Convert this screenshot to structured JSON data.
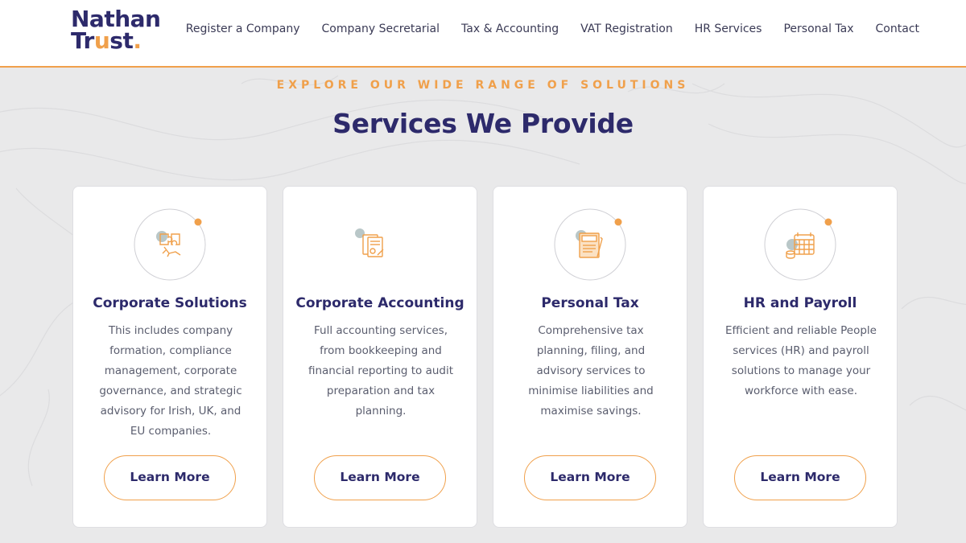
{
  "brand": {
    "line1": "Nathan",
    "line2_a": "Tr",
    "line2_b": "u",
    "line2_c": "st",
    "dot": "."
  },
  "nav": [
    "Register a Company",
    "Company Secretarial",
    "Tax & Accounting",
    "VAT Registration",
    "HR Services",
    "Personal Tax",
    "Contact"
  ],
  "section": {
    "eyebrow": "EXPLORE OUR WIDE RANGE OF SOLUTIONS",
    "title": "Services We Provide"
  },
  "cards": [
    {
      "icon": "puzzle-hand-icon",
      "title": "Corporate Solutions",
      "text": "This includes company formation, compliance management, corporate governance, and strategic advisory for Irish, UK, and EU companies.",
      "button": "Learn More"
    },
    {
      "icon": "accounting-document-icon",
      "title": "Corporate Accounting",
      "text": "Full accounting services, from bookkeeping and financial reporting to audit preparation and tax planning.",
      "button": "Learn More"
    },
    {
      "icon": "tax-document-icon",
      "title": "Personal Tax",
      "text": "Comprehensive tax planning, filing, and advisory services to minimise liabilities and maximise savings.",
      "button": "Learn More"
    },
    {
      "icon": "calendar-payroll-icon",
      "title": "HR and Payroll",
      "text": "Efficient and reliable People services (HR) and payroll solutions to manage your workforce with ease.",
      "button": "Learn More"
    }
  ],
  "colors": {
    "accent": "#f0a04b",
    "navy": "#2d2a6b",
    "background": "#e9e9ea"
  }
}
